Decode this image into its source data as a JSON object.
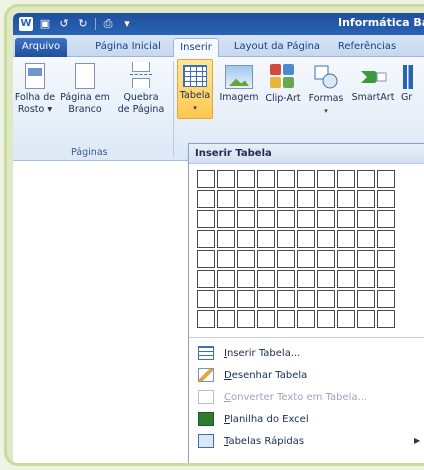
{
  "titlebar": {
    "title": "Informática Básica",
    "qat_icons": [
      "word-icon",
      "save-icon",
      "undo-icon",
      "redo-icon",
      "print-icon",
      "customize-icon"
    ]
  },
  "tabs": [
    {
      "label": "Arquivo"
    },
    {
      "label": "Página Inicial"
    },
    {
      "label": "Inserir"
    },
    {
      "label": "Layout da Página"
    },
    {
      "label": "Referências"
    }
  ],
  "ribbon": {
    "pages_group": {
      "label": "Páginas",
      "cover": {
        "line1": "Folha de",
        "line2": "Rosto ▾"
      },
      "blank": {
        "line1": "Página em",
        "line2": "Branco"
      },
      "break": {
        "line1": "Quebra",
        "line2": "de Página"
      }
    },
    "table": {
      "label": "Tabela",
      "arrow": "▾"
    },
    "image": {
      "label": "Imagem"
    },
    "clipart": {
      "label": "Clip-Art"
    },
    "shapes": {
      "label": "Formas",
      "arrow": "▾"
    },
    "smartart": {
      "label": "SmartArt"
    },
    "chart": {
      "label": "Gr"
    }
  },
  "dropdown": {
    "header": "Inserir Tabela",
    "grid": {
      "columns": 10,
      "rows": 8
    },
    "menu": [
      {
        "label": "Inserir Tabela...",
        "icon": "insert-table-icon",
        "enabled": true
      },
      {
        "label": "Desenhar Tabela",
        "icon": "draw-table-icon",
        "enabled": true
      },
      {
        "label": "Converter Texto em Tabela...",
        "icon": "convert-text-icon",
        "enabled": false
      },
      {
        "label": "Planilha do Excel",
        "icon": "excel-icon",
        "enabled": true
      },
      {
        "label": "Tabelas Rápidas",
        "icon": "quick-tables-icon",
        "enabled": true,
        "submenu": true
      }
    ]
  },
  "colors": {
    "accent": "#2a63b5",
    "highlight": "#ffc84f",
    "frame": "#c9dc9e"
  }
}
